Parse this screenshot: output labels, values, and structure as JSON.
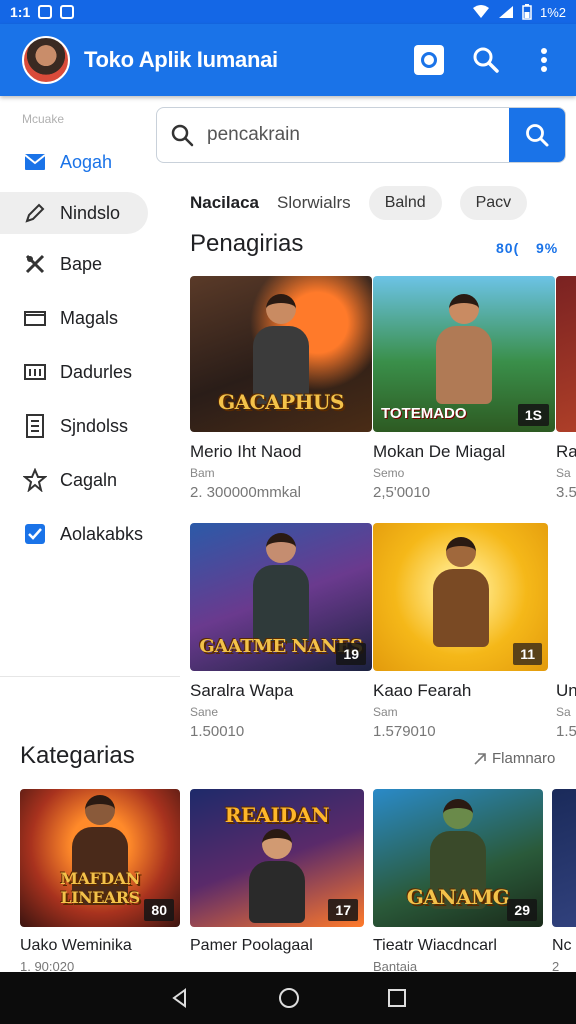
{
  "status_bar": {
    "time": "1:1",
    "right_text": "1%2"
  },
  "app_bar": {
    "title": "Toko Aplik Iumanai"
  },
  "sidebar": {
    "header": "Mcuake",
    "items": [
      {
        "label": "Aogah",
        "icon": "mail-icon"
      },
      {
        "label": "Nindslo",
        "icon": "edit-icon"
      },
      {
        "label": "Bape",
        "icon": "crossed-tools-icon"
      },
      {
        "label": "Magals",
        "icon": "folder-icon"
      },
      {
        "label": "Dadurles",
        "icon": "calendar-icon"
      },
      {
        "label": "Sjndolss",
        "icon": "document-icon"
      },
      {
        "label": "Cagaln",
        "icon": "star-icon"
      },
      {
        "label": "Aolakabks",
        "icon": "checkbox-icon"
      }
    ]
  },
  "search": {
    "placeholder": "pencakrain"
  },
  "filters": {
    "tab1": "Nacilaca",
    "tab2": "Slorwialrs",
    "chip1": "Balnd",
    "chip2": "Pacv"
  },
  "section1": {
    "title": "Penagirias",
    "extra1": "80(",
    "extra2": "9%"
  },
  "row1": [
    {
      "art": "GACAPHUS",
      "badge": "",
      "name": "Merio Iht Naod",
      "sub": "Bam",
      "meta": "2. 300000mmkal"
    },
    {
      "art": "TOTEMADO",
      "badge": "1S",
      "name": "Mokan De Miagal",
      "sub": "Semo",
      "meta": "2,5'0010"
    },
    {
      "art": "",
      "badge": "",
      "name": "Ra",
      "sub": "Sa",
      "meta": "3.5"
    }
  ],
  "row2": [
    {
      "art": "GAATME NANES",
      "badge": "19",
      "name": "Saralra Wapa",
      "sub": "Sane",
      "meta": "1.50010"
    },
    {
      "art": "",
      "badge": "11",
      "name": "Kaao Fearah",
      "sub": "Sam",
      "meta": "1.579010"
    },
    {
      "art": "",
      "badge": "",
      "name": "Un",
      "sub": "Sa",
      "meta": "1.5"
    }
  ],
  "section2": {
    "title": "Kategarias",
    "link": "Flamnaro"
  },
  "row3": [
    {
      "art": "MAFDAN LINEARS",
      "badge": "80",
      "name": "Uako Weminika",
      "sub": "1. 90:020"
    },
    {
      "art": "REAIDAN",
      "badge": "17",
      "name": "Pamer Poolagaal",
      "sub": ""
    },
    {
      "art": "GANAMG",
      "badge": "29",
      "name": "Tieatr Wiacdncarl",
      "sub": "Bantaia"
    },
    {
      "art": "",
      "badge": "",
      "name": "Nc",
      "sub": "2"
    }
  ]
}
